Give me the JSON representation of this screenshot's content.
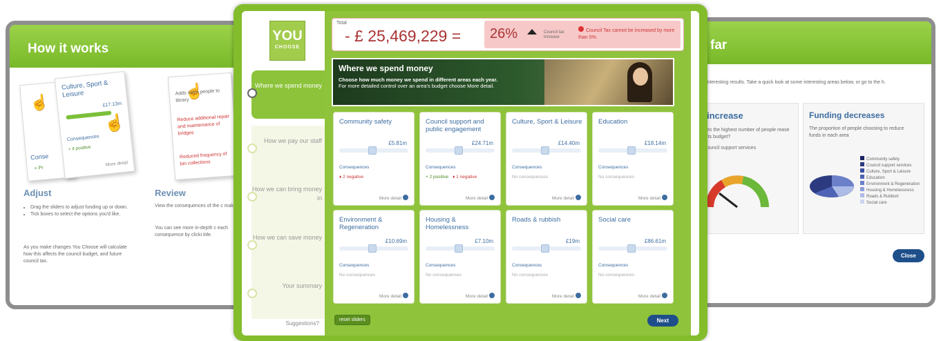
{
  "left_panel": {
    "title": "How it works",
    "card_culture": "Culture, Sport & Leisure",
    "card_amount": "£17.13m",
    "card_consequences": "Consequences",
    "card_positive": "+ 4 positive",
    "card_more": "More detail",
    "card_back1": "Conse",
    "card_back2": "+ Pr",
    "review_item1": "Adds more people to library",
    "review_item2": "Reduce additional repair and maintenance of bridges",
    "review_item3": "Reduced frequency of bin collections",
    "adjust_title": "Adjust",
    "adjust_bullets": [
      "Drag the sliders to adjust funding up or down.",
      "Tick boxes to select the options you'd like."
    ],
    "adjust_note": "As you make changes You Choose will calculate how this affects the council budget, and future council tax.",
    "review_title": "Review",
    "review_text1": "View the consequences of the c make.",
    "review_text2": "You can see more in-depth c each consequence by clicki title."
  },
  "right_panel": {
    "title": "far",
    "intro": "interesting results. Take a quick look at some interesting areas below, or go to the h.",
    "increase_title": "increase",
    "increase_text": "es the highest number of people rease its budget?",
    "increase_sub": "ouncil support services",
    "decrease_title": "Funding decreases",
    "decrease_text": "The proportion of people choosing to reduce funds in each area",
    "legend": [
      "Community safety",
      "Council support services",
      "Culture, Sport & Leisure",
      "Education",
      "Environment & Regeneration",
      "Housing & Homelessness",
      "Roads & Rubbish",
      "Social care"
    ],
    "legend_colors": [
      "#1a2460",
      "#2c3a80",
      "#3d4fa0",
      "#5064b5",
      "#6b80c8",
      "#8c9dd8",
      "#adbce6",
      "#cbd5ef"
    ],
    "close": "Close"
  },
  "logo": {
    "line1": "YOU",
    "line2": "CHOOSE"
  },
  "steps": [
    {
      "label": "Where we spend money",
      "active": true
    },
    {
      "label": "How we pay our staff",
      "active": false
    },
    {
      "label": "How we can bring money in",
      "active": false
    },
    {
      "label": "How we can save money",
      "active": false
    },
    {
      "label": "Your summary",
      "active": false
    }
  ],
  "suggestions": "Suggestions?",
  "total": {
    "label": "Total",
    "value": "- £ 25,469,229 =",
    "percent": "26%",
    "council_tax": "Council tax increase",
    "warning": "Council Tax cannot be increased by more than 5%."
  },
  "banner": {
    "title": "Where we spend money",
    "line1": "Choose how much money we spend in different areas each year.",
    "line2": "For more detailed control over an area's budget choose More detail."
  },
  "budgets": [
    {
      "name": "Community safety",
      "amount": "£5.81m",
      "level": 0.48,
      "consequences": [
        {
          "text": "2 negative",
          "kind": "neg"
        }
      ]
    },
    {
      "name": "Council support and public engagement",
      "amount": "£24.71m",
      "level": 0.48,
      "consequences": [
        {
          "text": "2 positive",
          "kind": "pos"
        },
        {
          "text": "1 negative",
          "kind": "neg"
        }
      ]
    },
    {
      "name": "Culture, Sport & Leisure",
      "amount": "£14.40m",
      "level": 0.48,
      "consequences": [
        {
          "text": "No consequences",
          "kind": "none"
        }
      ]
    },
    {
      "name": "Education",
      "amount": "£18.14m",
      "level": 0.48,
      "consequences": [
        {
          "text": "No consequences",
          "kind": "none"
        }
      ]
    },
    {
      "name": "Environment & Regeneration",
      "amount": "£10.69m",
      "level": 0.48,
      "consequences": [
        {
          "text": "No consequences",
          "kind": "none"
        }
      ]
    },
    {
      "name": "Housing & Homelessness",
      "amount": "£7.10m",
      "level": 0.48,
      "consequences": [
        {
          "text": "No consequences",
          "kind": "none"
        }
      ]
    },
    {
      "name": "Roads & rubbish",
      "amount": "£19m",
      "level": 0.48,
      "consequences": [
        {
          "text": "No consequences",
          "kind": "none"
        }
      ]
    },
    {
      "name": "Social care",
      "amount": "£86.61m",
      "level": 0.48,
      "consequences": [
        {
          "text": "No consequences",
          "kind": "none"
        }
      ]
    }
  ],
  "consequences_label": "Consequences",
  "more_detail": "More detail",
  "reset": "reset sliders",
  "next": "Next"
}
